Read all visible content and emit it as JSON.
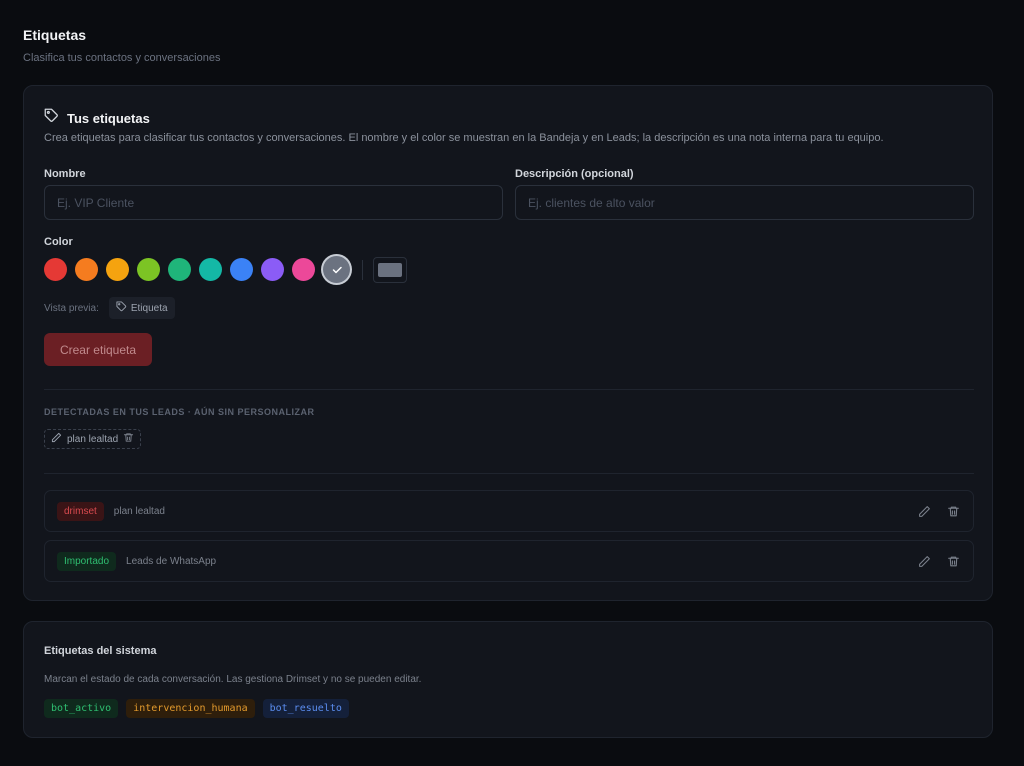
{
  "header": {
    "title": "Etiquetas",
    "subtitle": "Clasifica tus contactos y conversaciones"
  },
  "tags_card": {
    "icon": "tag-icon",
    "title": "Tus etiquetas",
    "description": "Crea etiquetas para clasificar tus contactos y conversaciones. El nombre y el color se muestran en la Bandeja y en Leads; la descripción es una nota interna para tu equipo.",
    "name_label": "Nombre",
    "name_placeholder": "Ej. VIP Cliente",
    "name_value": "",
    "desc_label": "Descripción (opcional)",
    "desc_placeholder": "Ej. clientes de alto valor",
    "desc_value": "",
    "color_label": "Color",
    "colors": [
      "#e53935",
      "#f57c1f",
      "#f5a30f",
      "#7cc424",
      "#1fb57a",
      "#14b8a6",
      "#3b82f6",
      "#8b5cf6",
      "#ec4899",
      "#6b7280"
    ],
    "selected_color": "#6b7280",
    "preview_label": "Vista previa:",
    "preview_chip": "Etiqueta",
    "create_button": "Crear etiqueta",
    "detected_title": "DETECTADAS EN TUS LEADS · AÚN SIN PERSONALIZAR",
    "detected": [
      {
        "label": "plan lealtad"
      }
    ],
    "tags": [
      {
        "name": "drimset",
        "desc": "plan lealtad",
        "color": "red"
      },
      {
        "name": "Importado",
        "desc": "Leads de WhatsApp",
        "color": "green"
      }
    ]
  },
  "system_card": {
    "title": "Etiquetas del sistema",
    "description": "Marcan el estado de cada conversación. Las gestiona Drimset y no se pueden editar.",
    "tags": [
      {
        "label": "bot_activo",
        "color": "green"
      },
      {
        "label": "intervencion_humana",
        "color": "orange"
      },
      {
        "label": "bot_resuelto",
        "color": "blue"
      }
    ]
  }
}
